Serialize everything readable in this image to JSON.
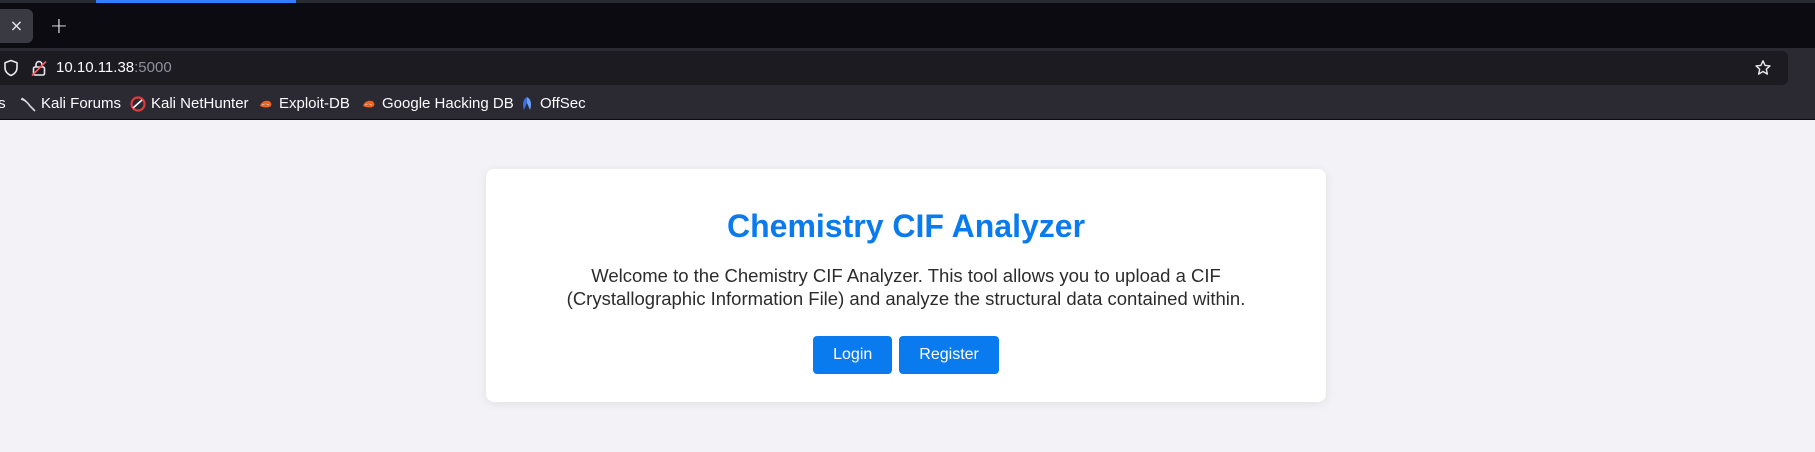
{
  "browser": {
    "tab_close_glyph": "×",
    "new_tab_glyph": "+",
    "url_host": "10.10.11.38",
    "url_port": ":5000",
    "bookmarks": [
      {
        "label": "ts",
        "icon": "partial-bookmark"
      },
      {
        "label": "Kali Forums",
        "icon": "kali-dragon-icon"
      },
      {
        "label": "Kali NetHunter",
        "icon": "nethunter-icon"
      },
      {
        "label": "Exploit-DB",
        "icon": "exploit-db-icon"
      },
      {
        "label": "Google Hacking DB",
        "icon": "exploit-db-icon"
      },
      {
        "label": "OffSec",
        "icon": "offsec-icon"
      }
    ]
  },
  "colors": {
    "accent": "#0a7bef",
    "page_bg": "#f3f3f7",
    "chrome_dark": "#0b0b11",
    "chrome": "#2b2a33"
  },
  "main": {
    "title": "Chemistry CIF Analyzer",
    "description": "Welcome to the Chemistry CIF Analyzer. This tool allows you to upload a CIF (Crystallographic Information File) and analyze the structural data contained within.",
    "login_label": "Login",
    "register_label": "Register"
  }
}
